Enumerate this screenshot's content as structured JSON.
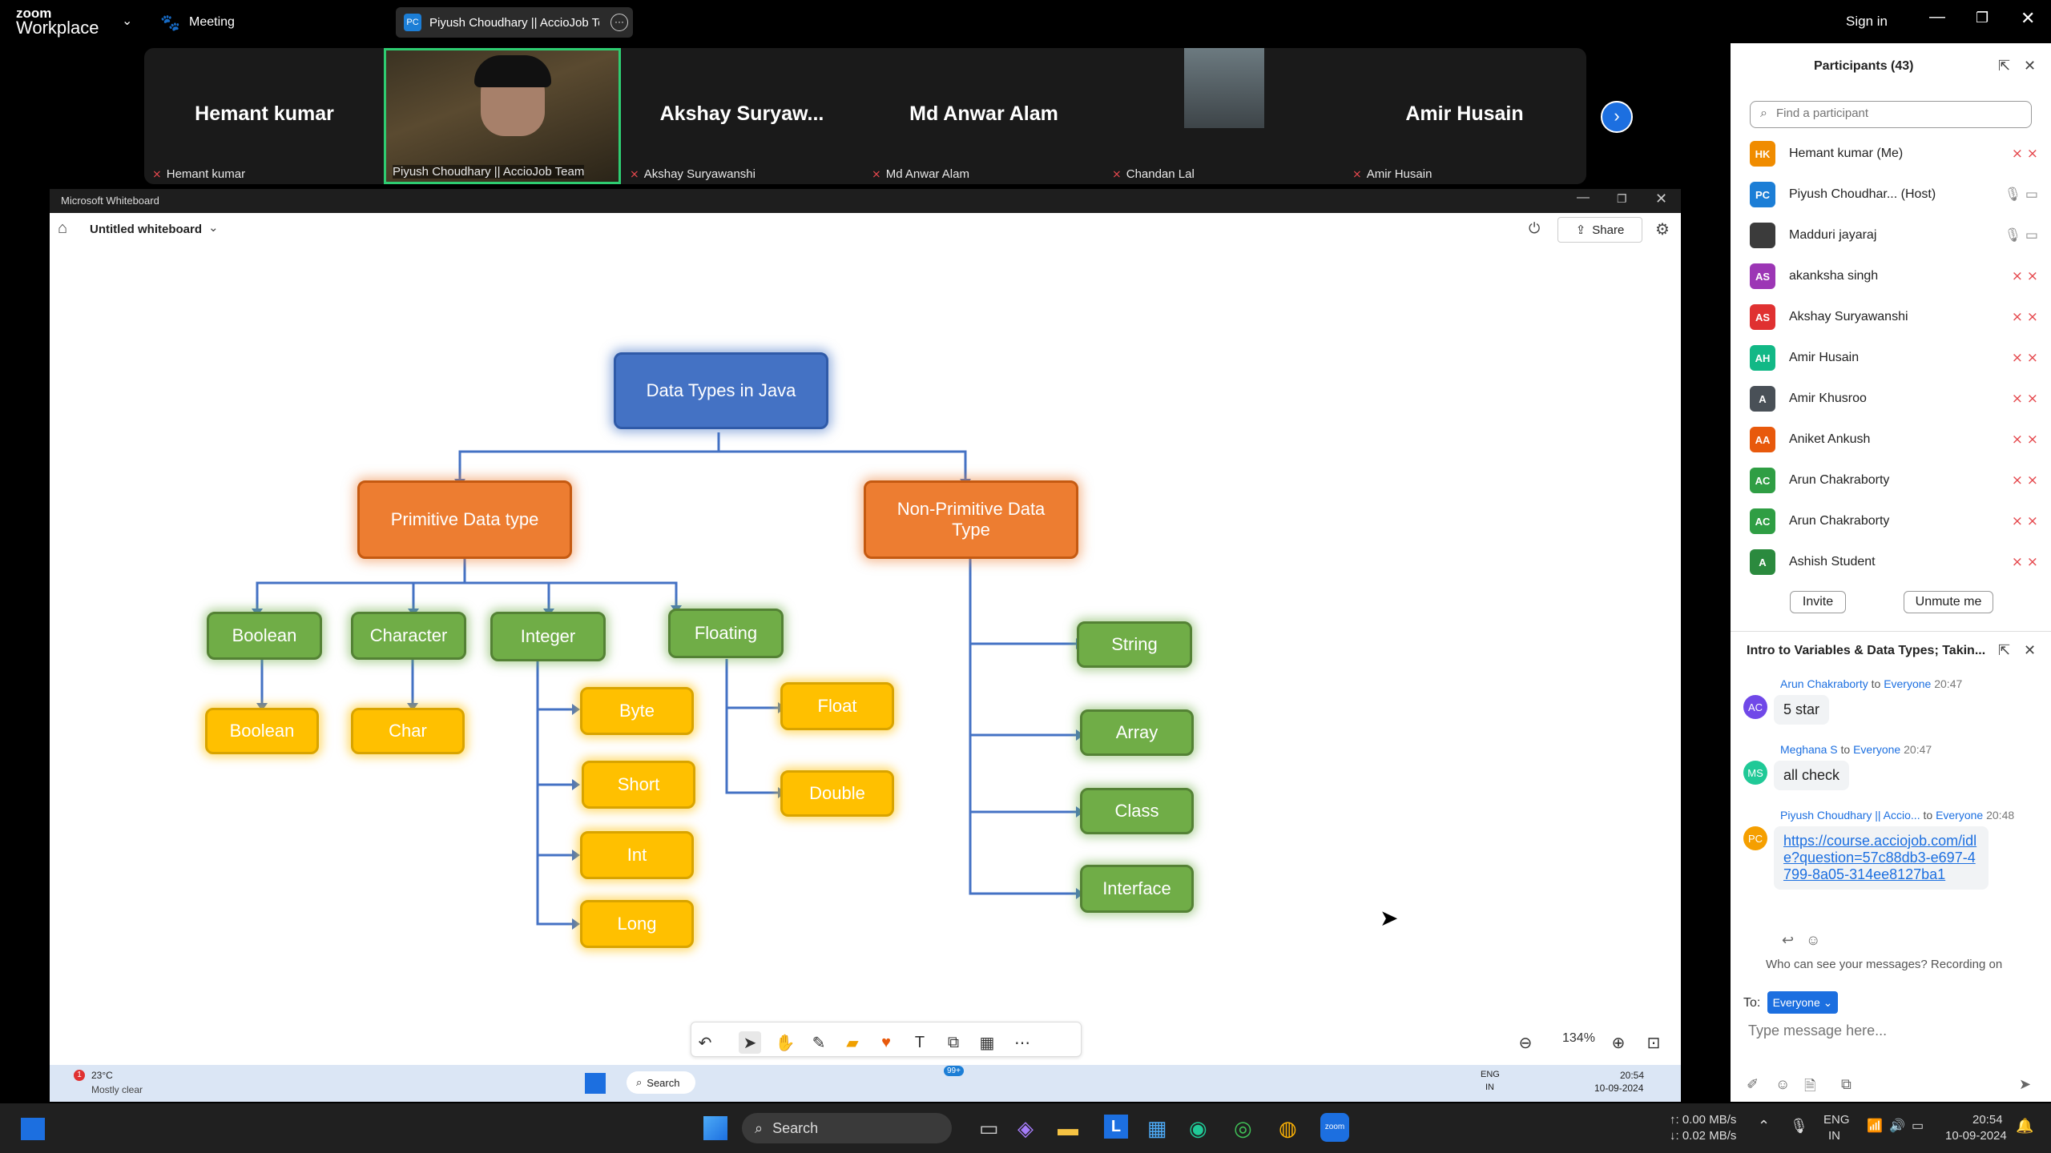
{
  "zoom": {
    "logo_top": "zoom",
    "logo_bottom": "Workplace",
    "meeting_label": "Meeting",
    "active_tab": "Piyush Choudhary || AccioJob Tea",
    "active_tab_initials": "PC",
    "signin": "Sign in"
  },
  "videos": [
    {
      "big": "Hemant kumar",
      "label": "Hemant kumar"
    },
    {
      "big": "",
      "label": "Piyush Choudhary || AccioJob Team"
    },
    {
      "big": "Akshay  Suryaw...",
      "label": "Akshay Suryawanshi"
    },
    {
      "big": "Md Anwar Alam",
      "label": "Md Anwar Alam"
    },
    {
      "big": "",
      "label": "Chandan Lal"
    },
    {
      "big": "Amir Husain",
      "label": "Amir Husain"
    }
  ],
  "whiteboard": {
    "window_title": "Microsoft Whiteboard",
    "doc_title": "Untitled whiteboard",
    "share": "Share",
    "zoom": "134%"
  },
  "diagram": {
    "root": "Data Types in Java",
    "primitive": "Primitive Data type",
    "non_primitive": "Non-Primitive Data Type",
    "boolean": "Boolean",
    "character": "Character",
    "integer": "Integer",
    "floating": "Floating",
    "boolean_leaf": "Boolean",
    "char": "Char",
    "byte": "Byte",
    "short": "Short",
    "int": "Int",
    "long": "Long",
    "float": "Float",
    "double": "Double",
    "string": "String",
    "array": "Array",
    "class": "Class",
    "interface": "Interface"
  },
  "inner_taskbar": {
    "weather_temp": "23°C",
    "weather_text": "Mostly clear",
    "weather_badge": "1",
    "search": "Search",
    "badge": "99+",
    "lang1": "ENG",
    "lang2": "IN",
    "time": "20:54",
    "date": "10-09-2024"
  },
  "participants": {
    "title": "Participants (43)",
    "search_placeholder": "Find a participant",
    "list": [
      {
        "initials": "HK",
        "name": "Hemant kumar (Me)",
        "color": "#f08c00"
      },
      {
        "initials": "PC",
        "name": "Piyush Choudhar... (Host)",
        "color": "#1c7ed6"
      },
      {
        "initials": "",
        "name": "Madduri jayaraj",
        "color": "#3b3b3b"
      },
      {
        "initials": "AS",
        "name": "akanksha singh",
        "color": "#9c36b5"
      },
      {
        "initials": "AS",
        "name": "Akshay Suryawanshi",
        "color": "#e03131"
      },
      {
        "initials": "AH",
        "name": "Amir Husain",
        "color": "#12b886"
      },
      {
        "initials": "A",
        "name": "Amir Khusroo",
        "color": "#495057"
      },
      {
        "initials": "AA",
        "name": "Aniket Ankush",
        "color": "#e8590c"
      },
      {
        "initials": "AC",
        "name": "Arun Chakraborty",
        "color": "#2f9e44"
      },
      {
        "initials": "AC",
        "name": "Arun Chakraborty",
        "color": "#2f9e44"
      },
      {
        "initials": "A",
        "name": "Ashish Student",
        "color": "#2b8a3e"
      }
    ],
    "invite": "Invite",
    "unmute": "Unmute me"
  },
  "chat": {
    "title": "Intro to Variables & Data Types; Takin...",
    "messages": [
      {
        "initials": "AC",
        "color": "#7048e8",
        "sender": "Arun Chakraborty",
        "to": "to",
        "target": "Everyone",
        "time": "20:47",
        "text": "5 star"
      },
      {
        "initials": "MS",
        "color": "#20c997",
        "sender": "Meghana S",
        "to": "to",
        "target": "Everyone",
        "time": "20:47",
        "text": "all check"
      },
      {
        "initials": "PC",
        "color": "#f59f00",
        "sender": "Piyush Choudhary || Accio...",
        "to": "to",
        "target": "Everyone",
        "time": "20:48",
        "text": "https://course.acciojob.com/idle?question=57c88db3-e697-4799-8a05-314ee8127ba1"
      }
    ],
    "privacy": "Who can see your messages? Recording on",
    "to_label": "To:",
    "to_value": "Everyone",
    "input_placeholder": "Type message here..."
  },
  "os": {
    "search": "Search",
    "net_up": "↑: 0.00 MB/s",
    "net_down": "↓: 0.02 MB/s",
    "lang1": "ENG",
    "lang2": "IN",
    "time": "20:54",
    "date": "10-09-2024"
  }
}
